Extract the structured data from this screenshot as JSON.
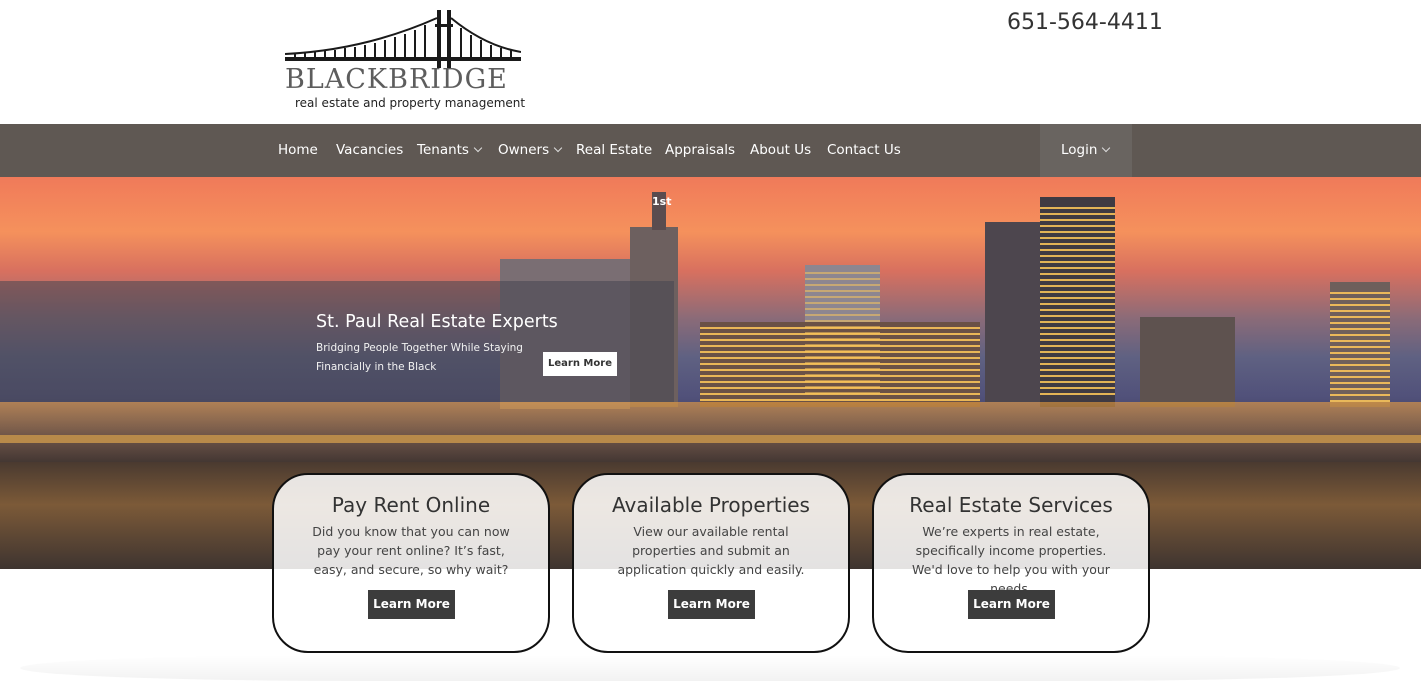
{
  "header": {
    "logo_word": "BLACKBRIDGE",
    "logo_tagline": "real estate and property management",
    "phone": "651-564-4411"
  },
  "nav": {
    "items": [
      {
        "label": "Home",
        "dropdown": false
      },
      {
        "label": "Vacancies",
        "dropdown": false
      },
      {
        "label": "Tenants",
        "dropdown": true
      },
      {
        "label": "Owners",
        "dropdown": true
      },
      {
        "label": "Real Estate",
        "dropdown": false
      },
      {
        "label": "Appraisals",
        "dropdown": false
      },
      {
        "label": "About Us",
        "dropdown": false
      },
      {
        "label": "Contact Us",
        "dropdown": false
      }
    ],
    "login_label": "Login"
  },
  "hero": {
    "title": "St. Paul Real Estate Experts",
    "subtitle": "Bridging People Together While Staying Financially in the Black",
    "button_label": "Learn More",
    "sign_text": "1st"
  },
  "cards": [
    {
      "title": "Pay Rent Online",
      "text": "Did you know that you can now pay your rent online? It’s fast, easy, and secure, so why wait?",
      "button_label": "Learn More"
    },
    {
      "title": "Available Properties",
      "text": "View our available rental properties and submit an application quickly and easily.",
      "button_label": "Learn More"
    },
    {
      "title": "Real Estate Services",
      "text": "We’re experts in real estate, specifically income properties. We'd love to help you with your needs.",
      "button_label": "Learn More"
    }
  ],
  "colors": {
    "nav_bg": "#5f5853",
    "login_bg": "#696460",
    "button_dark": "#3c3c3c",
    "logo_gray": "#5d5d5d"
  },
  "icons": {
    "dropdown": "chevron-down-icon",
    "logo": "bridge-icon"
  }
}
